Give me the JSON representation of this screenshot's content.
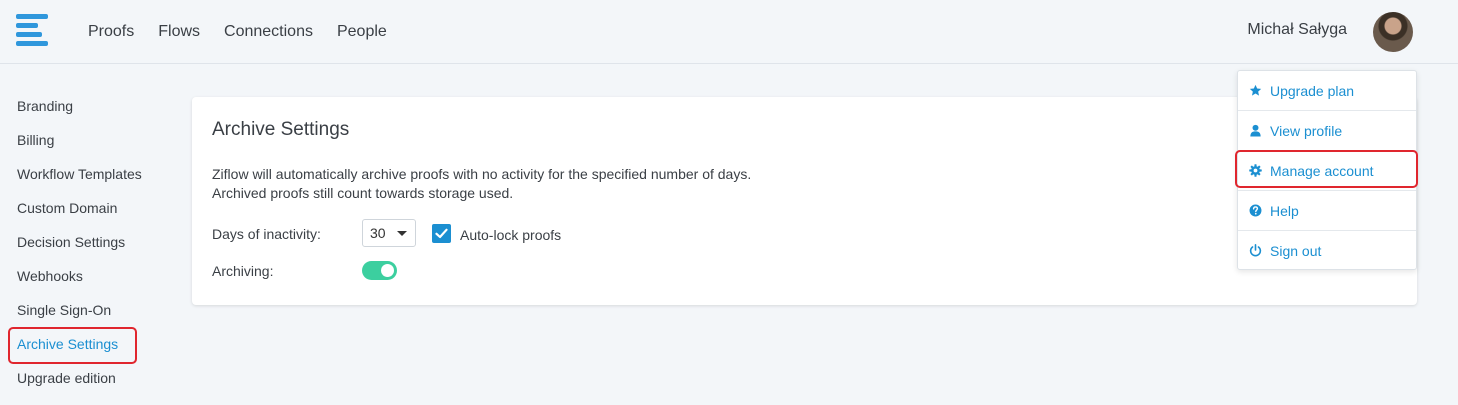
{
  "header": {
    "nav": [
      "Proofs",
      "Flows",
      "Connections",
      "People"
    ],
    "user_name": "Michał Sałyga",
    "logo_icon": "ziflow-logo-icon",
    "avatar_icon": "user-avatar-photo"
  },
  "sidebar": {
    "items": [
      {
        "label": "Branding"
      },
      {
        "label": "Billing"
      },
      {
        "label": "Workflow Templates"
      },
      {
        "label": "Custom Domain"
      },
      {
        "label": "Decision Settings"
      },
      {
        "label": "Webhooks"
      },
      {
        "label": "Single Sign-On"
      },
      {
        "label": "Archive Settings",
        "active": true
      },
      {
        "label": "Upgrade edition"
      }
    ]
  },
  "main": {
    "title": "Archive Settings",
    "description_line1": "Ziflow will automatically archive proofs with no activity for the specified number of days.",
    "description_line2": "Archived proofs still count towards storage used.",
    "days_label": "Days of inactivity:",
    "days_value": "30",
    "auto_lock_label": "Auto-lock proofs",
    "auto_lock_checked": true,
    "archiving_label": "Archiving:",
    "archiving_on": true
  },
  "user_menu": {
    "items": [
      {
        "label": "Upgrade plan",
        "icon": "star-icon"
      },
      {
        "label": "View profile",
        "icon": "user-icon"
      },
      {
        "label": "Manage account",
        "icon": "gear-icon"
      },
      {
        "label": "Help",
        "icon": "question-circle-icon"
      },
      {
        "label": "Sign out",
        "icon": "power-icon"
      }
    ]
  },
  "colors": {
    "accent": "#1b8fd1",
    "toggle_on": "#3ccf9f",
    "highlight": "#e0262e",
    "logo": "#2f97dc"
  }
}
